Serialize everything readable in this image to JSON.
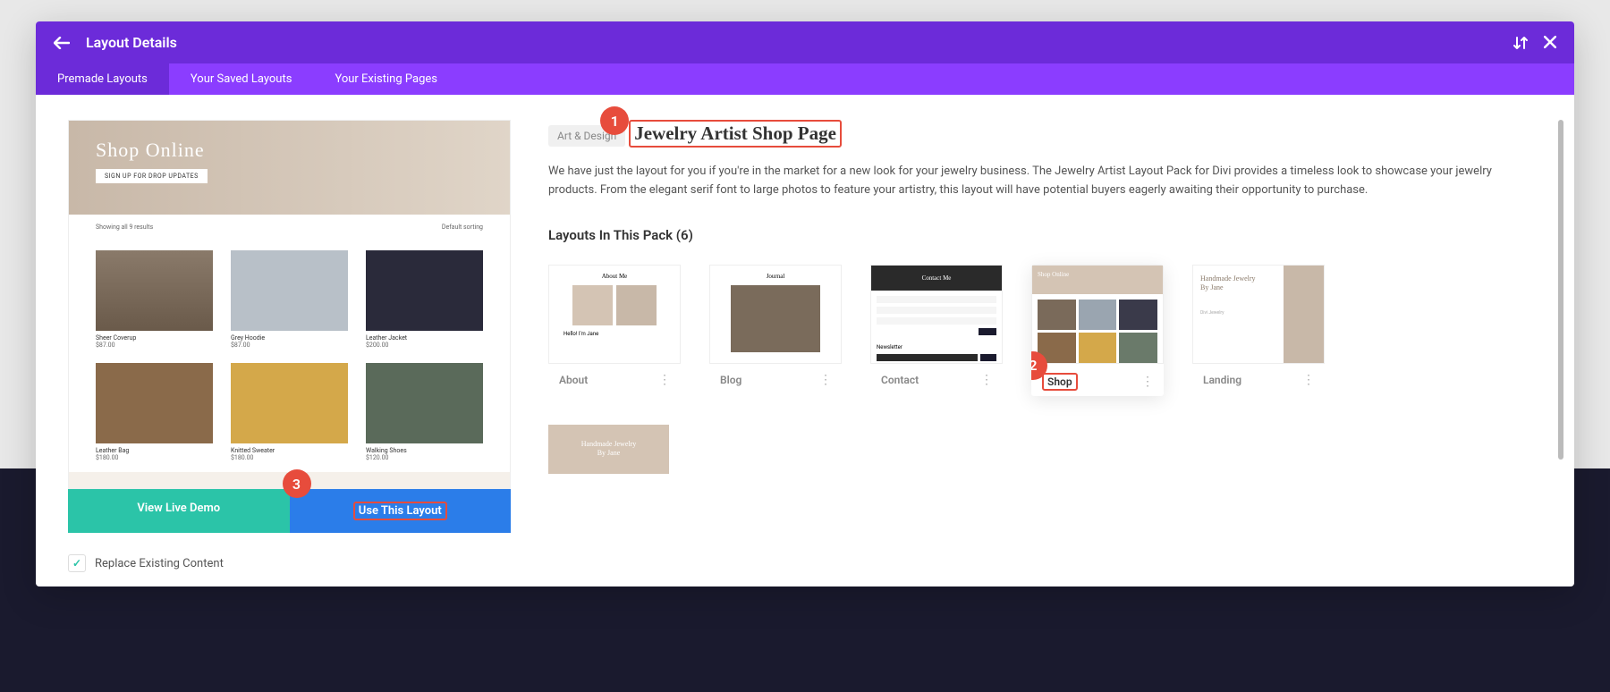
{
  "header": {
    "title": "Layout Details"
  },
  "tabs": {
    "premade": "Premade Layouts",
    "saved": "Your Saved Layouts",
    "existing": "Your Existing Pages"
  },
  "preview": {
    "hero_title": "Shop Online",
    "hero_btn": "SIGN UP FOR DROP UPDATES",
    "showing": "Showing all 9 results",
    "sorting": "Default sorting",
    "products": [
      {
        "name": "Sheer Coverup",
        "price": "$87.00"
      },
      {
        "name": "Grey Hoodie",
        "price": "$87.00"
      },
      {
        "name": "Leather Jacket",
        "price": "$200.00"
      },
      {
        "name": "Leather Bag",
        "price": "$180.00"
      },
      {
        "name": "Knitted Sweater",
        "price": "$180.00"
      },
      {
        "name": "Walking Shoes",
        "price": "$120.00"
      }
    ]
  },
  "actions": {
    "view_demo": "View Live Demo",
    "use_layout": "Use This Layout",
    "replace_content": "Replace Existing Content"
  },
  "details": {
    "category": "Art & Design",
    "title": "Jewelry Artist Shop Page",
    "description": "We have just the layout for you if you're in the market for a new look for your jewelry business. The Jewelry Artist Layout Pack for Divi provides a timeless look to showcase your jewelry products. From the elegant serif font to large photos to feature your artistry, this layout will have potential buyers eagerly awaiting their opportunity to purchase.",
    "pack_heading": "Layouts In This Pack (6)"
  },
  "layouts": [
    {
      "name": "About"
    },
    {
      "name": "Blog"
    },
    {
      "name": "Contact"
    },
    {
      "name": "Shop"
    },
    {
      "name": "Landing"
    }
  ],
  "thumbs": {
    "about": {
      "title": "About Me",
      "subtitle": "Hello! I'm Jane"
    },
    "blog": {
      "title": "Journal"
    },
    "contact": {
      "title": "Contact Me",
      "newsletter": "Newsletter"
    },
    "shop": {
      "title": "Shop Online"
    },
    "landing": {
      "title": "Handmade Jewelry\nBy Jane",
      "brand": "Divi Jewelry"
    },
    "secondary": {
      "title": "Handmade Jewelry\nBy Jane"
    }
  },
  "annotations": {
    "a1": "1",
    "a2": "2",
    "a3": "3"
  }
}
